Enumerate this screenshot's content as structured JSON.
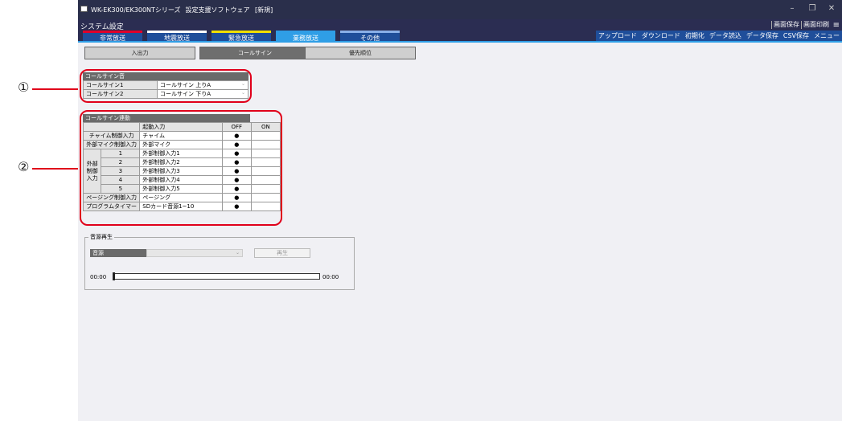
{
  "callouts": [
    "①",
    "②"
  ],
  "window": {
    "title": "WK-EK300/EK300NTシリーズ",
    "subtitle": "設定支援ソフトウェア",
    "status": "[新規]",
    "controls": [
      "–",
      "❐",
      "✕"
    ]
  },
  "header": {
    "title": "システム設定",
    "tabs": [
      {
        "label": "非常放送",
        "color": "#e0002a"
      },
      {
        "label": "地震放送",
        "color": "#ffffff"
      },
      {
        "label": "緊急放送",
        "color": "#f0e000"
      },
      {
        "label": "業務放送",
        "color": "#2f9ee6"
      },
      {
        "label": "その他",
        "color": "#8ab0e8"
      }
    ],
    "print_tools": [
      "画面保存",
      "画面印刷"
    ],
    "menu_icon": "≡",
    "tools": [
      "アップロード",
      "ダウンロード",
      "初期化",
      "データ読込",
      "データ保存",
      "CSV保存",
      "メニュー"
    ]
  },
  "subtabs": [
    "入出力",
    "コールサイン",
    "優先順位"
  ],
  "callsign_sound": {
    "title": "コールサイン音",
    "rows": [
      {
        "label": "コールサイン1",
        "value": "コールサイン 上りA"
      },
      {
        "label": "コールサイン2",
        "value": "コールサイン 下りA"
      }
    ]
  },
  "callsign_link": {
    "title": "コールサイン連動",
    "col_headers": [
      "起動入力",
      "OFF",
      "ON"
    ],
    "rows": [
      {
        "label": "チャイム制御入力",
        "input": "チャイム",
        "off": "●",
        "on": ""
      },
      {
        "label": "外部マイク制御入力",
        "input": "外部マイク",
        "off": "●",
        "on": ""
      }
    ],
    "ext_label": "外部制御入力",
    "ext_rows": [
      {
        "num": "1",
        "input": "外部制御入力1",
        "off": "●",
        "on": ""
      },
      {
        "num": "2",
        "input": "外部制御入力2",
        "off": "●",
        "on": ""
      },
      {
        "num": "3",
        "input": "外部制御入力3",
        "off": "●",
        "on": ""
      },
      {
        "num": "4",
        "input": "外部制御入力4",
        "off": "●",
        "on": ""
      },
      {
        "num": "5",
        "input": "外部制御入力5",
        "off": "●",
        "on": ""
      }
    ],
    "tail_rows": [
      {
        "label": "ページング制御入力",
        "input": "ページング",
        "off": "●",
        "on": ""
      },
      {
        "label": "プログラムタイマー",
        "input": "SDカード音源1~10",
        "off": "●",
        "on": ""
      }
    ]
  },
  "playback": {
    "title": "音源再生",
    "source_label": "音源",
    "play_label": "再生",
    "time_start": "00:00",
    "time_end": "00:00",
    "dropdown_arrow": "⌄",
    "progress": 0
  }
}
